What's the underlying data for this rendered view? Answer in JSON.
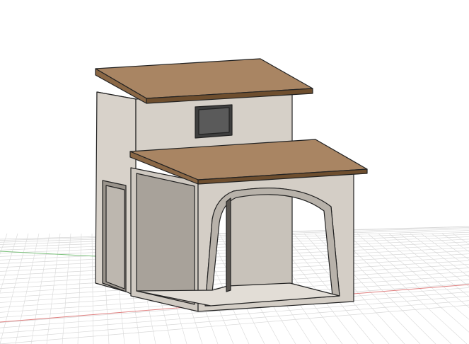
{
  "viewport": {
    "background": "#ffffff",
    "grid_color": "#d8d8d8",
    "grid_major_color": "#c4c4c4",
    "x_axis_color": "#e06060",
    "y_axis_color": "#60c060"
  },
  "model": {
    "roof_color": "#a88460",
    "roof_edge_color": "#7a5a3a",
    "wall_front_color": "#d6d0c8",
    "wall_side_color": "#c2bcb4",
    "wall_inner_color": "#b4aea6",
    "window_color": "#4a4a4a",
    "outline_color": "#222222"
  },
  "icons": {
    "viewcube": "",
    "axis_indicator": ""
  }
}
